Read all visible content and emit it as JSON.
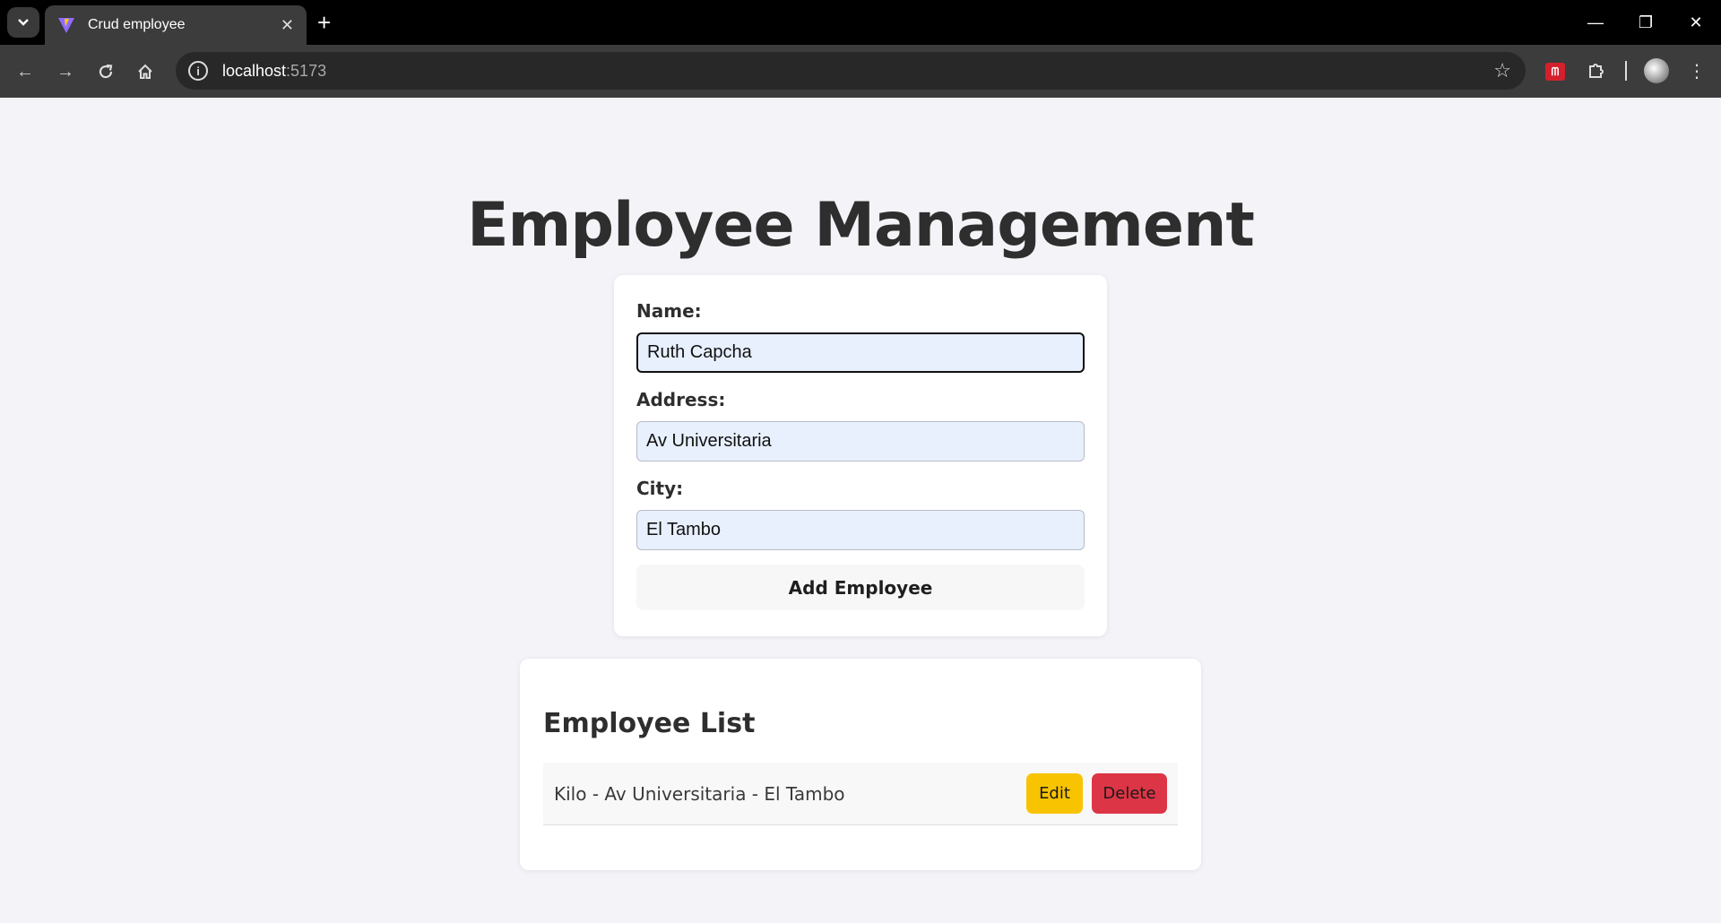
{
  "browser": {
    "tab_title": "Crud employee",
    "url_host": "localhost",
    "url_port": ":5173",
    "icons": {
      "tab_search": "chevron-down-icon",
      "tab_close": "close-icon",
      "new_tab": "plus-icon",
      "back": "arrow-left-icon",
      "forward": "arrow-right-icon",
      "reload": "reload-icon",
      "home": "home-icon",
      "site_info": "info-icon",
      "bookmark": "star-icon",
      "extensions": "puzzle-icon",
      "menu": "kebab-menu-icon"
    }
  },
  "page": {
    "title": "Employee Management"
  },
  "form": {
    "name_label": "Name:",
    "name_value": "Ruth Capcha",
    "address_label": "Address:",
    "address_value": "Av Universitaria",
    "city_label": "City:",
    "city_value": "El Tambo",
    "submit_label": "Add Employee"
  },
  "list": {
    "title": "Employee List",
    "items": [
      {
        "text": "Kilo - Av Universitaria - El Tambo",
        "edit_label": "Edit",
        "delete_label": "Delete"
      }
    ]
  },
  "colors": {
    "page_bg": "#f4f4f8",
    "edit": "#f8c300",
    "delete": "#dc3545",
    "input_bg": "#e8f0fe"
  }
}
